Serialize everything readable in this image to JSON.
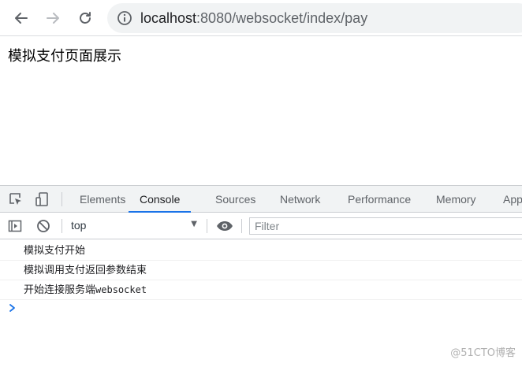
{
  "browser": {
    "url_host": "localhost",
    "url_rest": ":8080/websocket/index/pay"
  },
  "page": {
    "title": "模拟支付页面展示"
  },
  "devtools": {
    "tabs": [
      {
        "label": "Elements"
      },
      {
        "label": "Console"
      },
      {
        "label": "Sources"
      },
      {
        "label": "Network"
      },
      {
        "label": "Performance"
      },
      {
        "label": "Memory"
      },
      {
        "label": "App"
      }
    ],
    "active_tab": "Console",
    "context": "top",
    "filter_placeholder": "Filter",
    "logs": [
      {
        "text": "模拟支付开始"
      },
      {
        "text": "模拟调用支付返回参数结束"
      },
      {
        "text_cn": "开始连接服务端",
        "text_mono": "websocket"
      }
    ]
  },
  "watermark": "@51CTO博客",
  "colors": {
    "accent": "#1a73e8",
    "prompt": "#1a73e8"
  }
}
